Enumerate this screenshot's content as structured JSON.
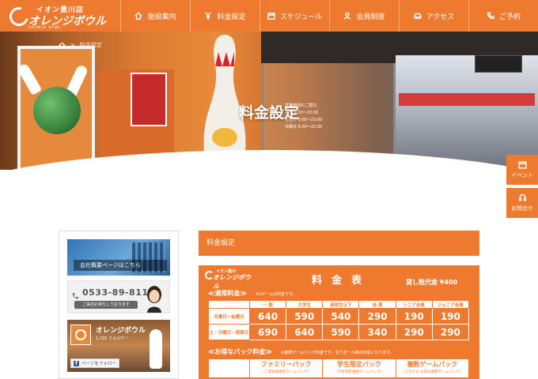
{
  "header": {
    "logo_sub": "イオン豊川店",
    "logo_main": "オレンジボウル",
    "logo_tag": "ORANGE BOWL",
    "nav": [
      {
        "label": "施設案内",
        "icon": "home-icon"
      },
      {
        "label": "料金設定",
        "icon": "yen-icon"
      },
      {
        "label": "スケジュール",
        "icon": "calendar-icon"
      },
      {
        "label": "会員制度",
        "icon": "person-icon"
      },
      {
        "label": "アクセス",
        "icon": "car-icon"
      },
      {
        "label": "ご予約",
        "icon": "phone-icon"
      }
    ]
  },
  "breadcrumb": {
    "current": "料金設定",
    "separator": ">"
  },
  "hero": {
    "title": "料金設定",
    "hours_heading": "営業時間のご案内",
    "hours": [
      "平日 9:00～23:00",
      "土曜日 8:00～23:00",
      "日曜日 8:00～22:00"
    ]
  },
  "side_tabs": {
    "event": "イベント",
    "contact": "お問合せ"
  },
  "sidebar": {
    "company_banner": "会社概要ページはこちら",
    "phone": "0533-89-8111",
    "phone_note": "ご来店お待ちしております",
    "fb_name": "オレンジボウル",
    "fb_followers": "1,720 フォロワー",
    "fb_follow": "ページをフォロー"
  },
  "main": {
    "section_title": "料金設定",
    "board": {
      "logo_sub": "イオン豊川",
      "logo_main": "オレンジボウル",
      "title": "料金表",
      "rental": "貸し靴代金 ¥400",
      "regular_label": "≪通常料金≫",
      "regular_note": "※1ゲームの料金です。",
      "columns": [
        "一 般",
        "大学生",
        "高校生以下",
        "会 員",
        "シニア会員",
        "ジュニア会員"
      ],
      "rows": [
        {
          "day": "月曜日～金曜日",
          "values": [
            "640",
            "590",
            "540",
            "290",
            "190",
            "190"
          ]
        },
        {
          "day": "土・日曜日・祝祭日",
          "values": [
            "690",
            "640",
            "590",
            "340",
            "290",
            "290"
          ]
        }
      ],
      "pack_label": "≪お得なパック料金≫",
      "pack_note": "※複数ゲームパック料金です。全てお一人様の料金になります。",
      "packs": [
        {
          "name": "ファミリーパック",
          "sub": "（ご家族様限定ゲームパック）"
        },
        {
          "name": "学生限定パック",
          "sub": "（学生限定複数ゲームパック）"
        },
        {
          "name": "複数ゲームパック",
          "sub": "（どなたも お得な複数ゲームパック）"
        }
      ]
    }
  }
}
